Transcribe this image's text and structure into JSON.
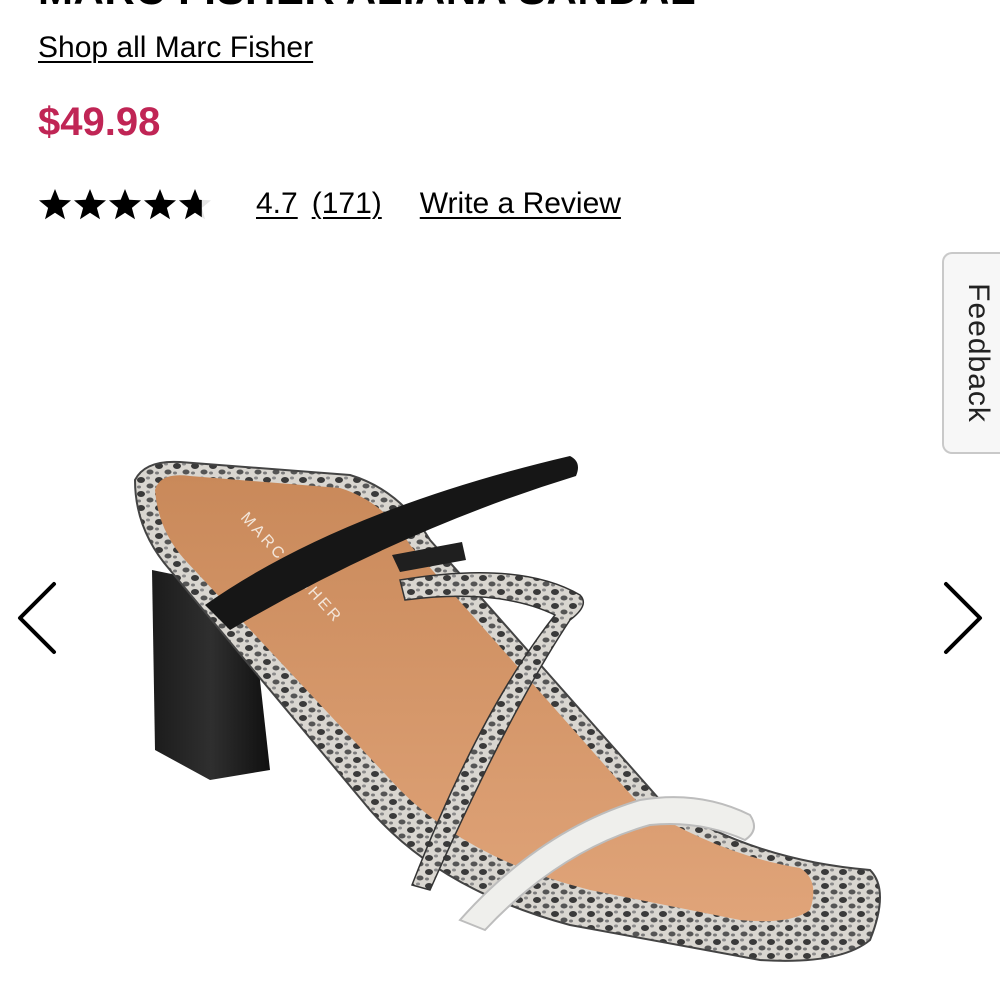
{
  "product": {
    "title": "MARC FISHER ALIANA SANDAL",
    "shop_all_label": "Shop all Marc Fisher",
    "price": "$49.98",
    "price_color": "#c02555"
  },
  "rating": {
    "stars": 4.7,
    "stars_max": 5,
    "value": "4.7",
    "count": "(171)",
    "write_review_label": "Write a Review"
  },
  "feedback": {
    "label": "Feedback"
  },
  "gallery": {
    "prev_icon": "chevron-left-icon",
    "next_icon": "chevron-right-icon",
    "image_alt": "Marc Fisher Aliana sandal with snake print and black straps on a block heel",
    "insole_text": "MARC FISHER"
  }
}
